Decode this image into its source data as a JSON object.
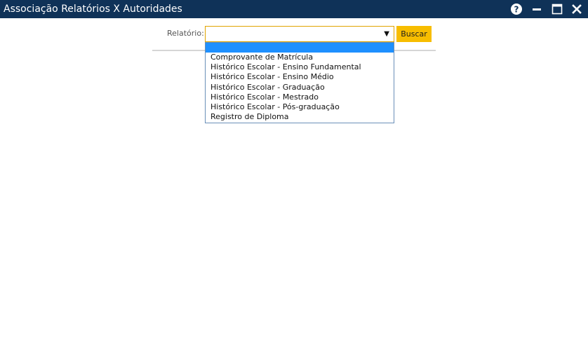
{
  "window": {
    "title": "Associação Relatórios X Autoridades",
    "help_icon": "help-icon",
    "minimize_icon": "minimize-icon",
    "maximize_icon": "maximize-icon",
    "close_icon": "close-icon"
  },
  "form": {
    "relatorio_label": "Relatório:",
    "relatorio_value": "",
    "buscar_label": "Buscar"
  },
  "dropdown": {
    "options": [
      "",
      "Comprovante de Matrícula",
      "Histórico Escolar - Ensino Fundamental",
      "Histórico Escolar - Ensino Médio",
      "Histórico Escolar - Graduação",
      "Histórico Escolar - Mestrado",
      "Histórico Escolar - Pós-graduação",
      "Registro de Diploma"
    ],
    "highlighted_index": 0
  },
  "colors": {
    "titlebar": "#0f3258",
    "button": "#f7bd00",
    "highlight": "#1e90ff",
    "select_border": "#e0a400"
  }
}
